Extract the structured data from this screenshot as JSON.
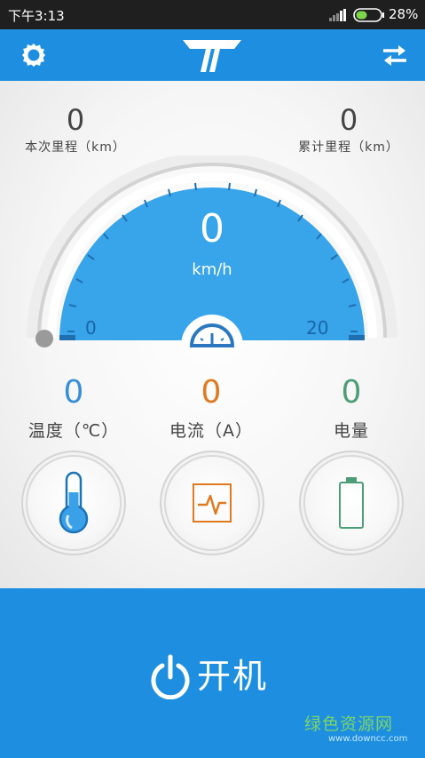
{
  "status_bar": {
    "time": "下午3:13",
    "battery_percent": "28%"
  },
  "trip": {
    "current_value": "0",
    "current_label": "本次里程（km）",
    "total_value": "0",
    "total_label": "累计里程（km）"
  },
  "speedometer": {
    "value": "0",
    "unit": "km/h",
    "min_label": "0",
    "max_label": "20"
  },
  "stats": {
    "temperature_value": "0",
    "temperature_label": "温度（℃）",
    "current_value": "0",
    "current_label": "电流（A）",
    "power_value": "0",
    "power_label": "电量"
  },
  "power_button": {
    "label": "开机"
  },
  "watermark": {
    "text": "绿色资源网",
    "url": "www.downcc.com"
  },
  "colors": {
    "primary_blue": "#1e8fe0",
    "temperature": "#3a8ed9",
    "current": "#e07a21",
    "power": "#4d9e77"
  }
}
